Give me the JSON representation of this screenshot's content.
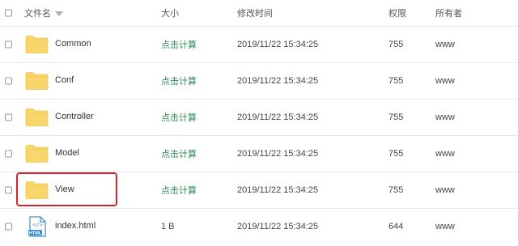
{
  "header": {
    "name": "文件名",
    "size": "大小",
    "modified": "修改时间",
    "permission": "权限",
    "owner": "所有者"
  },
  "rows": [
    {
      "name": "Common",
      "type": "folder",
      "size": "点击计算",
      "modified": "2019/11/22 15:34:25",
      "permission": "755",
      "owner": "www"
    },
    {
      "name": "Conf",
      "type": "folder",
      "size": "点击计算",
      "modified": "2019/11/22 15:34:25",
      "permission": "755",
      "owner": "www"
    },
    {
      "name": "Controller",
      "type": "folder",
      "size": "点击计算",
      "modified": "2019/11/22 15:34:25",
      "permission": "755",
      "owner": "www"
    },
    {
      "name": "Model",
      "type": "folder",
      "size": "点击计算",
      "modified": "2019/11/22 15:34:25",
      "permission": "755",
      "owner": "www"
    },
    {
      "name": "View",
      "type": "folder",
      "size": "点击计算",
      "modified": "2019/11/22 15:34:25",
      "permission": "755",
      "owner": "www",
      "highlighted": true
    },
    {
      "name": "index.html",
      "type": "html",
      "size": "1 B",
      "modified": "2019/11/22 15:34:25",
      "permission": "644",
      "owner": "www"
    }
  ],
  "icons": {
    "folder": "folder-icon",
    "html": "html-file-icon",
    "html_badge": "HTML"
  },
  "colors": {
    "folder": "#f9d66b",
    "size_link": "#2e8b57",
    "highlight": "#d9232f",
    "html_icon": "#3c8ec9"
  }
}
